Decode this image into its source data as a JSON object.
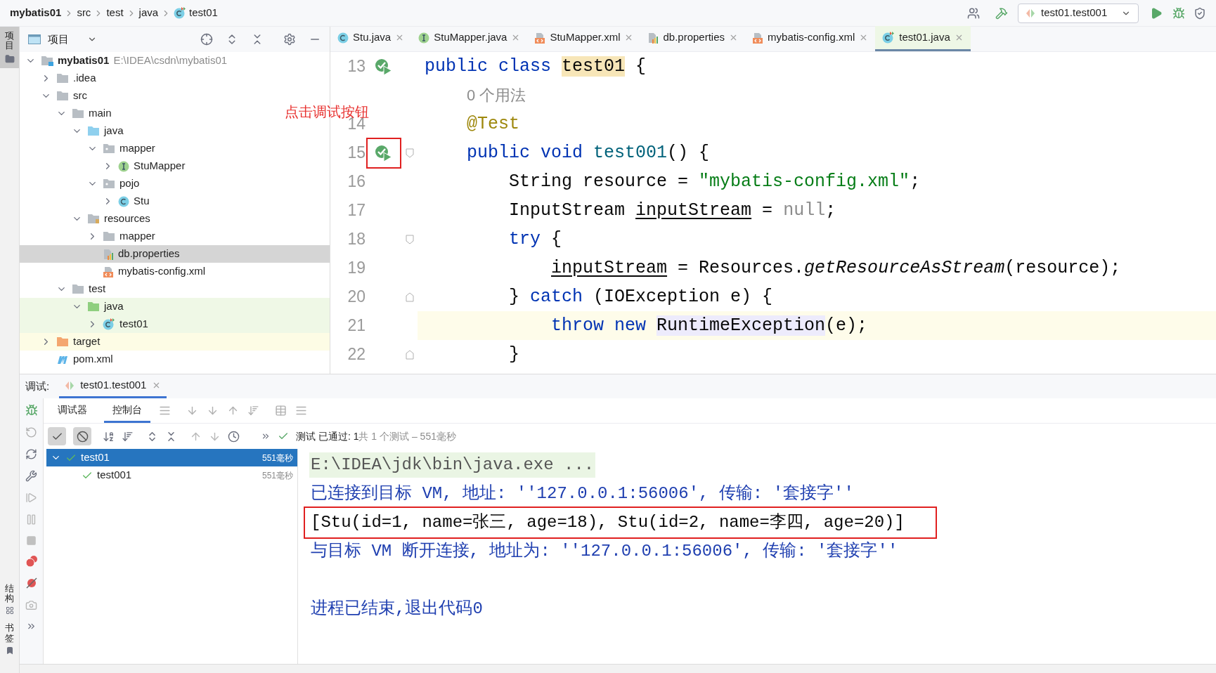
{
  "breadcrumb": [
    "mybatis01",
    "src",
    "test",
    "java",
    "test01"
  ],
  "toolbar": {
    "run_config": "test01.test001"
  },
  "side_stripe": {
    "top": "项目",
    "bottom": [
      "结构",
      "书签"
    ]
  },
  "project_panel": {
    "title": "项目",
    "tree": [
      {
        "label": "mybatis01",
        "path": "E:\\IDEA\\csdn\\mybatis01",
        "kind": "module",
        "expanded": true,
        "selected": false,
        "children": [
          {
            "label": ".idea",
            "kind": "folder",
            "expanded": false,
            "selected": false
          },
          {
            "label": "src",
            "kind": "folder",
            "expanded": true,
            "selected": false,
            "children": [
              {
                "label": "main",
                "kind": "folder",
                "expanded": true,
                "selected": false,
                "children": [
                  {
                    "label": "java",
                    "kind": "source",
                    "expanded": true,
                    "selected": false,
                    "children": [
                      {
                        "label": "mapper",
                        "kind": "package",
                        "expanded": true,
                        "selected": false,
                        "children": [
                          {
                            "label": "StuMapper",
                            "kind": "interface",
                            "expanded": false,
                            "selected": false
                          }
                        ]
                      },
                      {
                        "label": "pojo",
                        "kind": "package",
                        "expanded": true,
                        "selected": false,
                        "children": [
                          {
                            "label": "Stu",
                            "kind": "class",
                            "expanded": false,
                            "selected": false
                          }
                        ]
                      }
                    ]
                  },
                  {
                    "label": "resources",
                    "kind": "resources",
                    "expanded": true,
                    "selected": false,
                    "children": [
                      {
                        "label": "mapper",
                        "kind": "folder",
                        "expanded": false,
                        "selected": false
                      },
                      {
                        "label": "db.properties",
                        "kind": "properties",
                        "selected": true
                      },
                      {
                        "label": "mybatis-config.xml",
                        "kind": "xml",
                        "selected": false
                      }
                    ]
                  }
                ]
              },
              {
                "label": "test",
                "kind": "folder",
                "expanded": true,
                "selected": false,
                "children": [
                  {
                    "label": "java",
                    "kind": "testsource",
                    "expanded": true,
                    "selected": false,
                    "children": [
                      {
                        "label": "test01",
                        "kind": "testclass",
                        "expanded": false,
                        "selected": false
                      }
                    ]
                  }
                ]
              }
            ]
          },
          {
            "label": "target",
            "kind": "excluded",
            "expanded": false,
            "selected": false
          },
          {
            "label": "pom.xml",
            "kind": "maven",
            "selected": false
          }
        ]
      }
    ]
  },
  "editor_tabs": [
    {
      "label": "Stu.java",
      "kind": "class",
      "selected": false
    },
    {
      "label": "StuMapper.java",
      "kind": "interface",
      "selected": false
    },
    {
      "label": "StuMapper.xml",
      "kind": "xml",
      "selected": false
    },
    {
      "label": "db.properties",
      "kind": "properties",
      "selected": false
    },
    {
      "label": "mybatis-config.xml",
      "kind": "xml",
      "selected": false
    },
    {
      "label": "test01.java",
      "kind": "testclass",
      "selected": true
    }
  ],
  "annotation_label": "点击调试按钮",
  "code_lines": [
    {
      "kind": "code",
      "number": "13",
      "run_marker": true,
      "fold_start": false,
      "fold_end": false,
      "current": false,
      "annotated": false,
      "tokens": [
        {
          "text": "public class ",
          "kind": "keyword"
        },
        {
          "text": "test01",
          "kind": "match"
        },
        {
          "text": " {",
          "kind": "plain"
        }
      ]
    },
    {
      "kind": "hint",
      "text": "0 个用法",
      "current": false,
      "annotated": false
    },
    {
      "kind": "code",
      "number": "14",
      "run_marker": false,
      "fold_start": false,
      "fold_end": false,
      "current": false,
      "annotated": false,
      "tokens": [
        {
          "text": "    @Test",
          "kind": "annotation"
        }
      ]
    },
    {
      "kind": "code",
      "number": "15",
      "run_marker": true,
      "fold_start": true,
      "fold_end": false,
      "current": false,
      "annotated": true,
      "tokens": [
        {
          "text": "    public void ",
          "kind": "keyword"
        },
        {
          "text": "test001",
          "kind": "declaration"
        },
        {
          "text": "() {",
          "kind": "plain"
        }
      ]
    },
    {
      "kind": "code",
      "number": "16",
      "run_marker": false,
      "fold_start": false,
      "fold_end": false,
      "current": false,
      "annotated": false,
      "tokens": [
        {
          "text": "        String resource = ",
          "kind": "plain"
        },
        {
          "text": "\"mybatis-config.xml\"",
          "kind": "string"
        },
        {
          "text": ";",
          "kind": "plain"
        }
      ]
    },
    {
      "kind": "code",
      "number": "17",
      "run_marker": false,
      "fold_start": false,
      "fold_end": false,
      "current": false,
      "annotated": false,
      "tokens": [
        {
          "text": "        InputStream ",
          "kind": "plain"
        },
        {
          "text": "inputStream",
          "kind": "reassigned"
        },
        {
          "text": " = ",
          "kind": "plain"
        },
        {
          "text": "null",
          "kind": "faded"
        },
        {
          "text": ";",
          "kind": "plain"
        }
      ]
    },
    {
      "kind": "code",
      "number": "18",
      "run_marker": false,
      "fold_start": true,
      "fold_end": false,
      "current": false,
      "annotated": false,
      "tokens": [
        {
          "text": "        try",
          "kind": "keyword"
        },
        {
          "text": " {",
          "kind": "plain"
        }
      ]
    },
    {
      "kind": "code",
      "number": "19",
      "run_marker": false,
      "fold_start": false,
      "fold_end": false,
      "current": false,
      "annotated": false,
      "tokens": [
        {
          "text": "            inputStream",
          "kind": "reassigned"
        },
        {
          "text": " = Resources.",
          "kind": "plain"
        },
        {
          "text": "getResourceAsStream",
          "kind": "static"
        },
        {
          "text": "(resource);",
          "kind": "plain"
        }
      ]
    },
    {
      "kind": "code",
      "number": "20",
      "run_marker": false,
      "fold_start": false,
      "fold_end": true,
      "current": false,
      "annotated": false,
      "tokens": [
        {
          "text": "        } ",
          "kind": "plain"
        },
        {
          "text": "catch",
          "kind": "keyword"
        },
        {
          "text": " (IOException e) {",
          "kind": "plain"
        }
      ]
    },
    {
      "kind": "code",
      "number": "21",
      "run_marker": false,
      "fold_start": false,
      "fold_end": false,
      "current": true,
      "annotated": false,
      "tokens": [
        {
          "text": "            throw new ",
          "kind": "keyword"
        },
        {
          "text": "RuntimeException",
          "kind": "usage"
        },
        {
          "text": "(e);",
          "kind": "plain"
        }
      ]
    },
    {
      "kind": "code",
      "number": "22",
      "run_marker": false,
      "fold_start": false,
      "fold_end": true,
      "current": false,
      "annotated": false,
      "tokens": [
        {
          "text": "        }",
          "kind": "plain"
        }
      ]
    }
  ],
  "debug_panel": {
    "label": "调试:",
    "session_tab": "test01.test001",
    "tabs": [
      {
        "label": "调试器",
        "selected": false
      },
      {
        "label": "控制台",
        "selected": true
      }
    ],
    "filters": [
      {
        "kind": "passed",
        "on": true
      },
      {
        "kind": "ignored",
        "on": true
      }
    ],
    "status_label": "测试 已通过: 1",
    "status_detail": "共 1 个测试 – 551毫秒",
    "tests": [
      {
        "name": "test01",
        "time": "551毫秒",
        "passed": true,
        "expanded": true,
        "selected": true,
        "children": [
          {
            "name": "test001",
            "time": "551毫秒",
            "passed": true,
            "selected": false
          }
        ]
      }
    ],
    "console": [
      {
        "kind": "command",
        "text": "E:\\IDEA\\jdk\\bin\\java.exe ...",
        "annotated": false
      },
      {
        "kind": "info",
        "text": "已连接到目标 VM, 地址: ''127.0.0.1:56006', 传输: '套接字''",
        "annotated": false
      },
      {
        "kind": "output",
        "text": "[Stu(id=1, name=张三, age=18), Stu(id=2, name=李四, age=20)]",
        "annotated": true
      },
      {
        "kind": "info",
        "text": "与目标 VM 断开连接, 地址为: ''127.0.0.1:56006', 传输: '套接字''",
        "annotated": false
      },
      {
        "kind": "blank",
        "annotated": false
      },
      {
        "kind": "info",
        "text": "进程已结束,退出代码0",
        "annotated": false
      }
    ]
  }
}
